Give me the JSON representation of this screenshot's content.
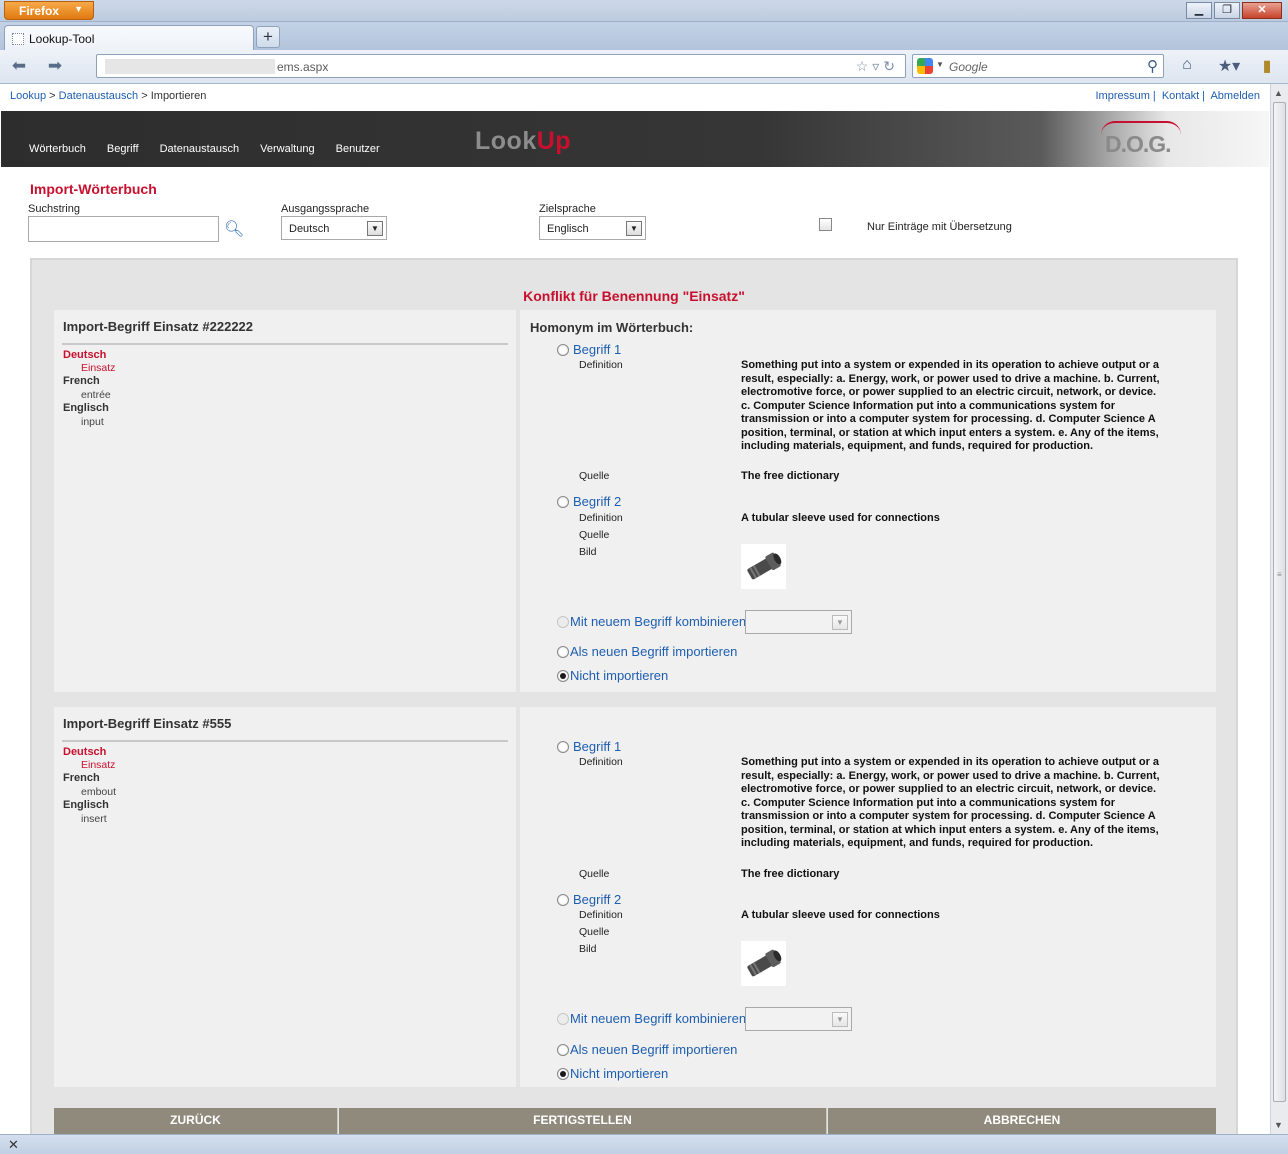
{
  "browser": {
    "app_button": "Firefox",
    "tab_title": "Lookup-Tool",
    "url_visible": "ems.aspx",
    "search_placeholder": "Google"
  },
  "page": {
    "breadcrumb": [
      "Lookup",
      "Datenaustausch",
      "Importieren"
    ],
    "breadcrumb_sep": ">",
    "top_links": [
      "Impressum",
      "Kontakt",
      "Abmelden"
    ],
    "nav": [
      "Wörterbuch",
      "Begriff",
      "Datenaustausch",
      "Verwaltung",
      "Benutzer"
    ],
    "logo": {
      "look": "Look",
      "up": "Up",
      "dog": "D.O.G."
    },
    "title": "Import-Wörterbuch",
    "filters": {
      "suchstring_label": "Suchstring",
      "suchstring_value": "",
      "ausgangssprache_label": "Ausgangssprache",
      "ausgangssprache_value": "Deutsch",
      "zielsprache_label": "Zielsprache",
      "zielsprache_value": "Englisch",
      "nur_uebersetzung_label": "Nur Einträge mit Übersetzung",
      "nur_uebersetzung_checked": false
    },
    "conflict_title": "Konflikt für Benennung \"Einsatz\"",
    "labels": {
      "homonym": "Homonym im Wörterbuch:",
      "definition": "Definition",
      "quelle": "Quelle",
      "bild": "Bild",
      "opt_combine": "Mit neuem Begriff kombinieren",
      "opt_import": "Als neuen Begriff importieren",
      "opt_skip": "Nicht importieren"
    },
    "blocks": [
      {
        "import_title": "Import-Begriff Einsatz #222222",
        "langs": [
          {
            "lang": "Deutsch",
            "word": "Einsatz"
          },
          {
            "lang": "French",
            "word": "entrée"
          },
          {
            "lang": "Englisch",
            "word": "input"
          }
        ],
        "begriffe": [
          {
            "name": "Begriff 1",
            "definition": "Something put into a system or expended in its operation to achieve output or a result, especially: a. Energy, work, or power used to drive a machine. b. Current, electromotive force, or power supplied to an electric circuit, network, or device. c. Computer Science Information put into a communications system for transmission or into a computer system for processing. d. Computer Science A position, terminal, or station at which input enters a system. e. Any of the items, including materials, equipment, and funds, required for production.",
            "quelle": "The free dictionary"
          },
          {
            "name": "Begriff 2",
            "definition": "A tubular sleeve used for connections",
            "quelle": ""
          }
        ],
        "selected_option": "Nicht importieren"
      },
      {
        "import_title": "Import-Begriff Einsatz #555",
        "langs": [
          {
            "lang": "Deutsch",
            "word": "Einsatz"
          },
          {
            "lang": "French",
            "word": "embout"
          },
          {
            "lang": "Englisch",
            "word": "insert"
          }
        ],
        "begriffe": [
          {
            "name": "Begriff 1",
            "definition": "Something put into a system or expended in its operation to achieve output or a result, especially: a. Energy, work, or power used to drive a machine. b. Current, electromotive force, or power supplied to an electric circuit, network, or device. c. Computer Science Information put into a communications system for transmission or into a computer system for processing. d. Computer Science A position, terminal, or station at which input enters a system. e. Any of the items, including materials, equipment, and funds, required for production.",
            "quelle": "The free dictionary"
          },
          {
            "name": "Begriff 2",
            "definition": "A tubular sleeve used for connections",
            "quelle": ""
          }
        ],
        "selected_option": "Nicht importieren"
      }
    ],
    "actions": [
      "ZURÜCK",
      "FERTIGSTELLEN",
      "ABBRECHEN"
    ]
  },
  "colors": {
    "accent_red": "#c8102e",
    "link_blue": "#1e5eb0",
    "button_gray": "#8f8a7c"
  }
}
